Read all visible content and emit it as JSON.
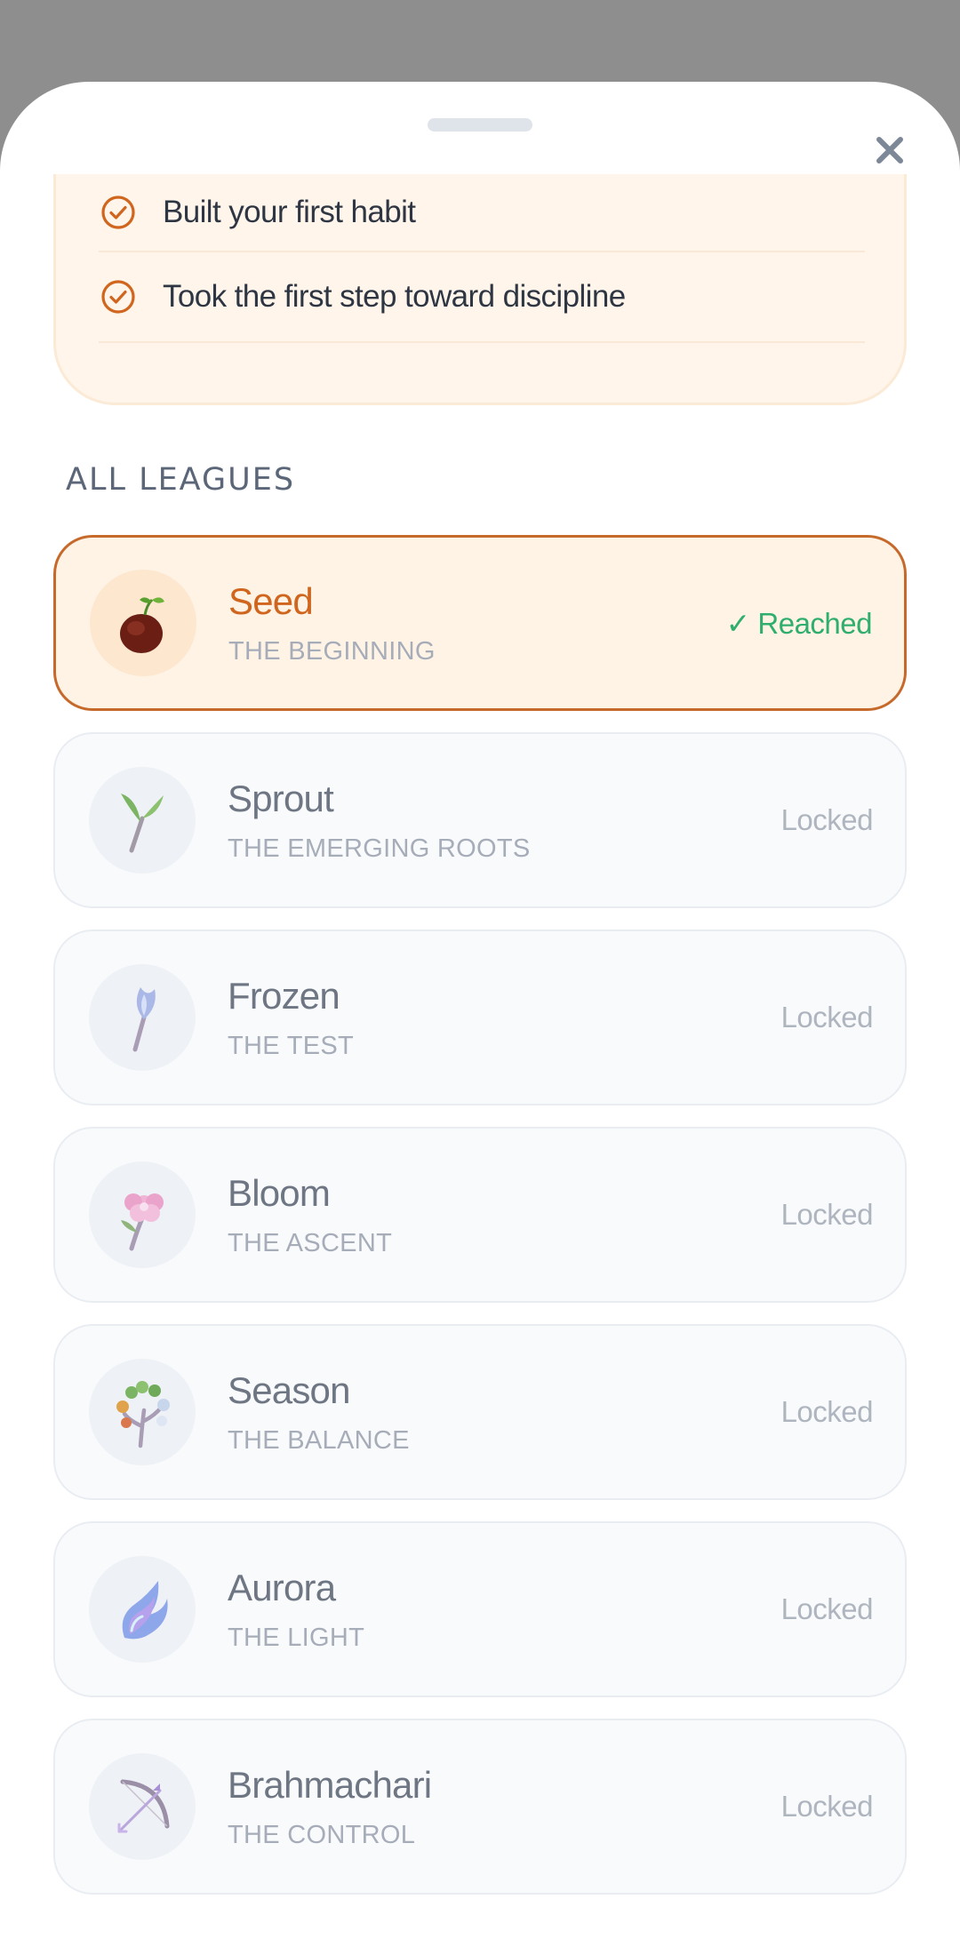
{
  "achievements": [
    {
      "label": "Built your first habit"
    },
    {
      "label": "Took the first step toward discipline"
    }
  ],
  "section_title": "ALL LEAGUES",
  "leagues": [
    {
      "name": "Seed",
      "subtitle": "THE BEGINNING",
      "status": "✓ Reached",
      "state": "reached",
      "icon": "seed-icon"
    },
    {
      "name": "Sprout",
      "subtitle": "THE EMERGING ROOTS",
      "status": "Locked",
      "state": "locked",
      "icon": "sprout-icon"
    },
    {
      "name": "Frozen",
      "subtitle": "THE TEST",
      "status": "Locked",
      "state": "locked",
      "icon": "frozen-branch-icon"
    },
    {
      "name": "Bloom",
      "subtitle": "THE ASCENT",
      "status": "Locked",
      "state": "locked",
      "icon": "bloom-flower-icon"
    },
    {
      "name": "Season",
      "subtitle": "THE BALANCE",
      "status": "Locked",
      "state": "locked",
      "icon": "season-tree-icon"
    },
    {
      "name": "Aurora",
      "subtitle": "THE LIGHT",
      "status": "Locked",
      "state": "locked",
      "icon": "aurora-flame-icon"
    },
    {
      "name": "Brahmachari",
      "subtitle": "THE CONTROL",
      "status": "Locked",
      "state": "locked",
      "icon": "bow-arrow-icon"
    }
  ],
  "colors": {
    "accent": "#d0651e",
    "reached_green": "#2fae6e",
    "overlay": "#8e8e8e"
  }
}
